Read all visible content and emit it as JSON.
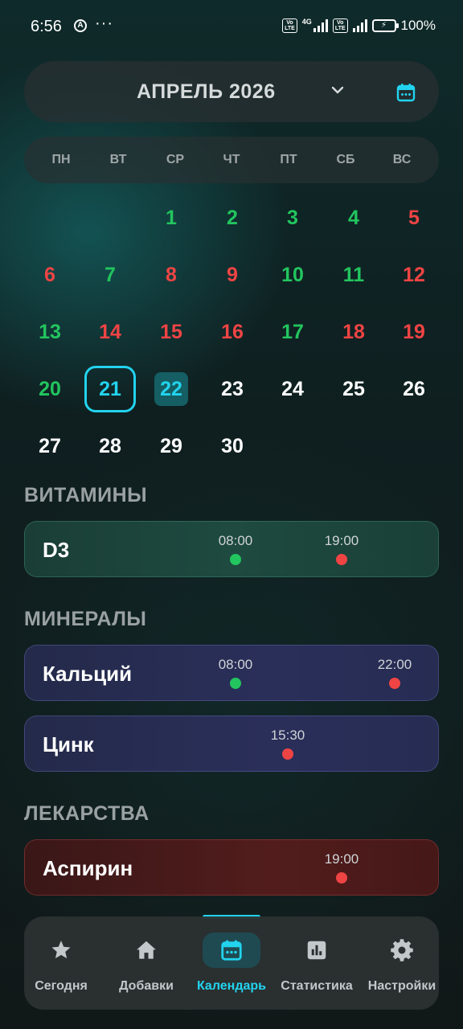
{
  "status_bar": {
    "time": "6:56",
    "network": "4G",
    "volte": "Vo LTE",
    "battery_percent": "100%"
  },
  "header": {
    "month_title": "АПРЕЛЬ 2026",
    "chevron_icon": "chevron-down-icon",
    "calendar_icon": "calendar-icon"
  },
  "weekdays": [
    "ПН",
    "ВТ",
    "СР",
    "ЧТ",
    "ПТ",
    "СБ",
    "ВС"
  ],
  "calendar": {
    "days": [
      {
        "label": "1",
        "status": "taken"
      },
      {
        "label": "2",
        "status": "taken"
      },
      {
        "label": "3",
        "status": "taken"
      },
      {
        "label": "4",
        "status": "taken"
      },
      {
        "label": "5",
        "status": "missed"
      },
      {
        "label": "6",
        "status": "missed"
      },
      {
        "label": "7",
        "status": "taken"
      },
      {
        "label": "8",
        "status": "missed"
      },
      {
        "label": "9",
        "status": "missed"
      },
      {
        "label": "10",
        "status": "taken"
      },
      {
        "label": "11",
        "status": "taken"
      },
      {
        "label": "12",
        "status": "missed"
      },
      {
        "label": "13",
        "status": "taken"
      },
      {
        "label": "14",
        "status": "missed"
      },
      {
        "label": "15",
        "status": "missed"
      },
      {
        "label": "16",
        "status": "missed"
      },
      {
        "label": "17",
        "status": "taken"
      },
      {
        "label": "18",
        "status": "missed"
      },
      {
        "label": "19",
        "status": "missed"
      },
      {
        "label": "20",
        "status": "taken"
      },
      {
        "label": "21",
        "status": "selected"
      },
      {
        "label": "22",
        "status": "today"
      },
      {
        "label": "23",
        "status": "future"
      },
      {
        "label": "24",
        "status": "future"
      },
      {
        "label": "25",
        "status": "future"
      },
      {
        "label": "26",
        "status": "future"
      },
      {
        "label": "27",
        "status": "future"
      },
      {
        "label": "28",
        "status": "future"
      },
      {
        "label": "29",
        "status": "future"
      },
      {
        "label": "30",
        "status": "future"
      }
    ]
  },
  "sections": {
    "vitamins": {
      "title": "ВИТАМИНЫ",
      "items": [
        {
          "name": "D3",
          "doses": [
            {
              "time": "08:00",
              "status": "taken"
            },
            {
              "time": "19:00",
              "status": "missed"
            }
          ]
        }
      ]
    },
    "minerals": {
      "title": "МИНЕРАЛЫ",
      "items": [
        {
          "name": "Кальций",
          "doses": [
            {
              "time": "08:00",
              "status": "taken"
            },
            {
              "time": "22:00",
              "status": "missed"
            }
          ]
        },
        {
          "name": "Цинк",
          "doses": [
            {
              "time": "15:30",
              "status": "missed"
            }
          ]
        }
      ]
    },
    "medicines": {
      "title": "ЛЕКАРСТВА",
      "items": [
        {
          "name": "Аспирин",
          "doses": [
            {
              "time": "19:00",
              "status": "missed"
            }
          ]
        }
      ]
    }
  },
  "colors": {
    "accent": "#22d3ee",
    "taken": "#22c55e",
    "missed": "#ef4444"
  },
  "bottom_nav": {
    "items": [
      {
        "label": "Сегодня",
        "icon": "star-icon",
        "active": false
      },
      {
        "label": "Добавки",
        "icon": "home-icon",
        "active": false
      },
      {
        "label": "Календарь",
        "icon": "calendar-icon",
        "active": true
      },
      {
        "label": "Статистика",
        "icon": "bar-chart-icon",
        "active": false
      },
      {
        "label": "Настройки",
        "icon": "gear-icon",
        "active": false
      }
    ]
  }
}
